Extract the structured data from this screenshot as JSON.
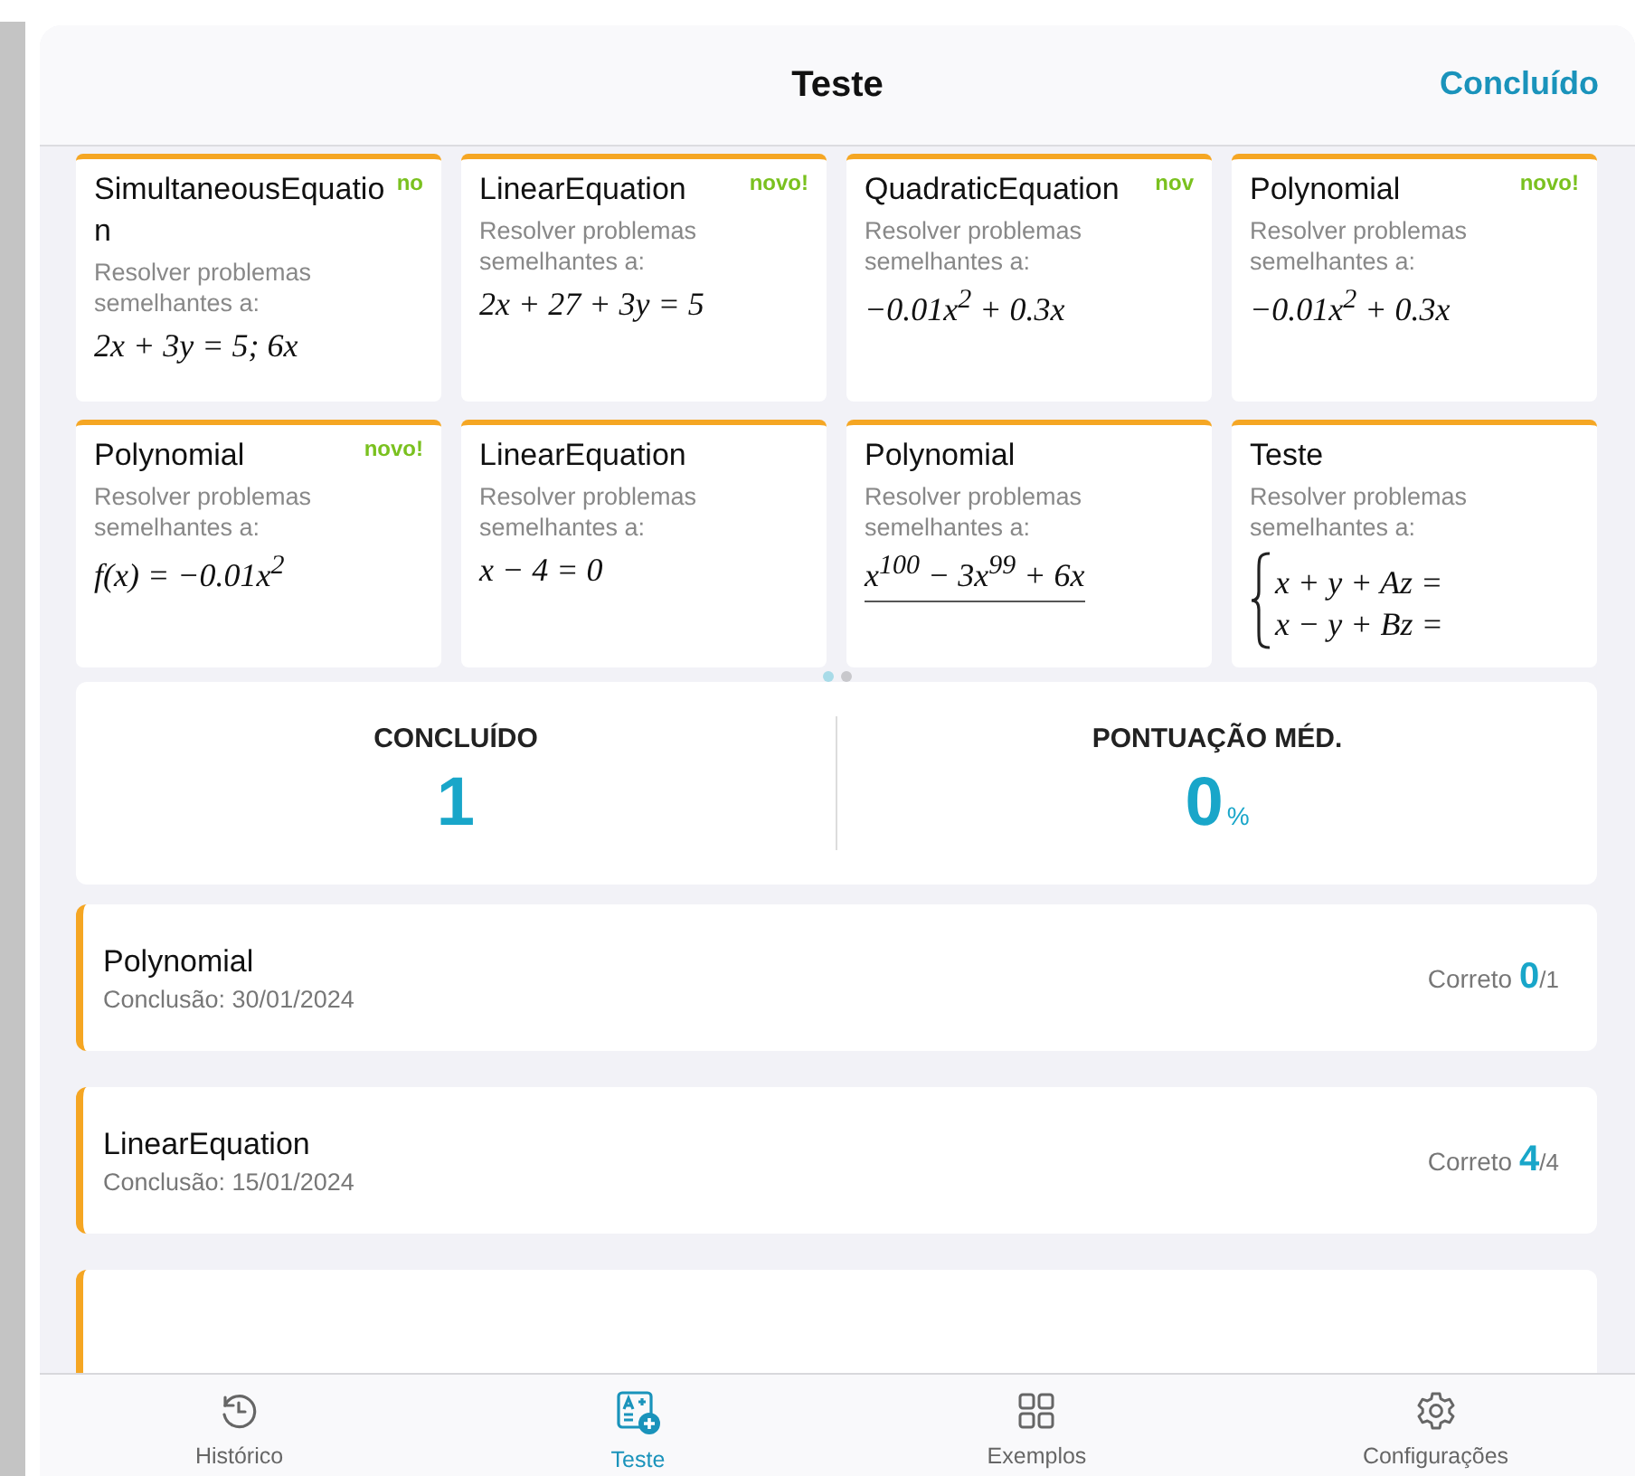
{
  "header": {
    "title": "Teste",
    "done_button": "Concluído"
  },
  "problem_cards": [
    {
      "title": "SimultaneousEquation",
      "badge": "no",
      "subtitle": "Resolver problemas semelhantes a:",
      "kind": "line",
      "formula": "2x + 3y = 5; 6x"
    },
    {
      "title": "LinearEquation",
      "badge": "novo!",
      "subtitle": "Resolver problemas semelhantes a:",
      "kind": "line",
      "formula": "2x + 27 + 3y = 5"
    },
    {
      "title": "QuadraticEquation",
      "badge": "nov",
      "subtitle": "Resolver problemas semelhantes a:",
      "kind": "line",
      "formula": "−0.01x$^{2}$ + 0.3x"
    },
    {
      "title": "Polynomial",
      "badge": "novo!",
      "subtitle": "Resolver problemas semelhantes a:",
      "kind": "line",
      "formula": "−0.01x$^{2}$ + 0.3x"
    },
    {
      "title": "Polynomial",
      "badge": "novo!",
      "subtitle": "Resolver problemas semelhantes a:",
      "kind": "line",
      "formula": "f(x) = −0.01x$^{2}$"
    },
    {
      "title": "LinearEquation",
      "subtitle": "Resolver problemas semelhantes a:",
      "kind": "line",
      "formula": "x − 4 = 0"
    },
    {
      "title": "Polynomial",
      "subtitle": "Resolver problemas semelhantes a:",
      "kind": "fraction",
      "formula": "x$^{100}$ − 3x$^{99}$ + 6x"
    },
    {
      "title": "Teste",
      "subtitle": "Resolver problemas semelhantes a:",
      "kind": "system",
      "lines": [
        "x + y + Az =",
        "x − y + Bz ="
      ]
    }
  ],
  "pager": [
    {
      "selected": true
    },
    {
      "selected": false
    }
  ],
  "stats": [
    {
      "label": "CONCLUÍDO",
      "value": "1"
    },
    {
      "label": "PONTUAÇÃO MÉD.",
      "value": "0",
      "unit": "%"
    }
  ],
  "history": [
    {
      "title": "Polynomial",
      "date": "Conclusão: 30/01/2024",
      "result_label": "Correto",
      "correct": "0",
      "total": "/1"
    },
    {
      "title": "LinearEquation",
      "date": "Conclusão: 15/01/2024",
      "result_label": "Correto",
      "correct": "4",
      "total": "/4"
    }
  ],
  "tab_bar": [
    {
      "label": "Histórico",
      "selected": false
    },
    {
      "label": "Teste",
      "selected": true
    },
    {
      "label": "Exemplos",
      "selected": false
    },
    {
      "label": "Configurações",
      "selected": false
    }
  ]
}
